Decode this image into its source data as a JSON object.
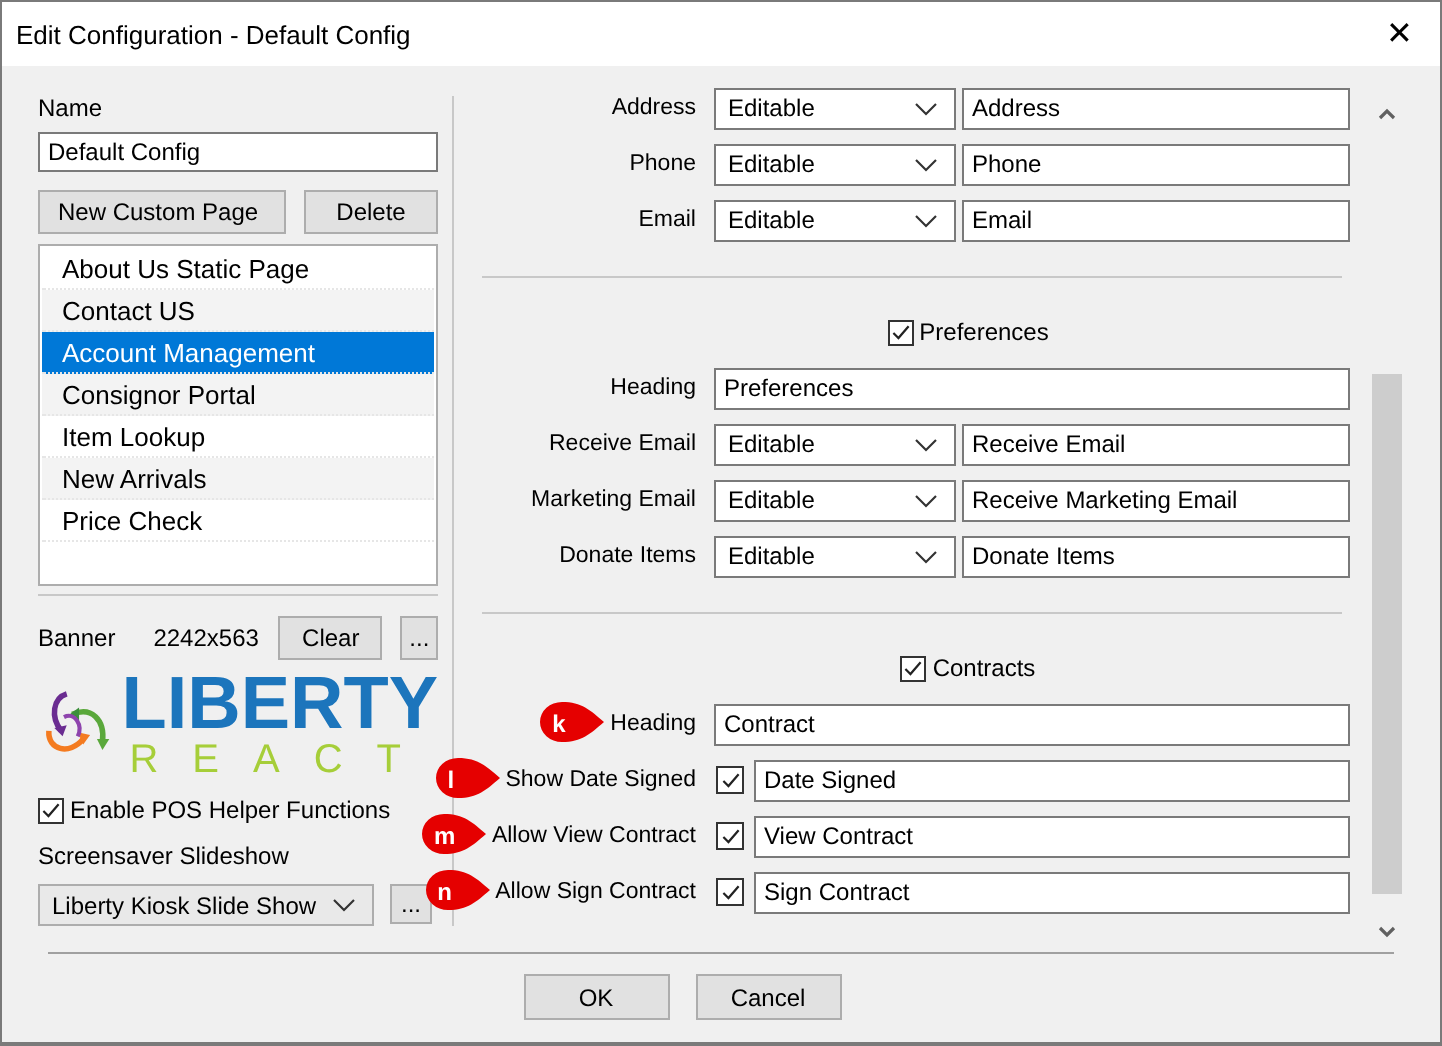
{
  "window": {
    "title": "Edit Configuration - Default Config",
    "close": "✕"
  },
  "left_panel": {
    "name_label": "Name",
    "name_value": "Default Config",
    "new_page_button": "New Custom Page",
    "delete_button": "Delete",
    "pages": [
      {
        "label": "About Us Static Page",
        "selected": false
      },
      {
        "label": "Contact US",
        "selected": false
      },
      {
        "label": "Account Management",
        "selected": true
      },
      {
        "label": "Consignor Portal",
        "selected": false
      },
      {
        "label": "Item Lookup",
        "selected": false
      },
      {
        "label": "New Arrivals",
        "selected": false
      },
      {
        "label": "Price Check",
        "selected": false
      }
    ],
    "banner_label": "Banner",
    "banner_size": "2242x563",
    "clear_button": "Clear",
    "banner_browse_button": "...",
    "logo": {
      "word_1": "LIBERTY",
      "word_2": "REACT"
    },
    "pos_helper": {
      "label": "Enable POS Helper Functions",
      "checked": true
    },
    "slideshow_label": "Screensaver Slideshow",
    "slideshow_value": "Liberty Kiosk Slide Show",
    "slideshow_browse_button": "..."
  },
  "sections": [
    {
      "rows": [
        {
          "kind": "select_text",
          "label": "Address",
          "mode": "Editable",
          "value": "Address"
        },
        {
          "kind": "select_text",
          "label": "Phone",
          "mode": "Editable",
          "value": "Phone"
        },
        {
          "kind": "select_text",
          "label": "Email",
          "mode": "Editable",
          "value": "Email"
        }
      ]
    },
    {
      "title": "Preferences",
      "checked": true,
      "rows": [
        {
          "kind": "text",
          "label": "Heading",
          "value": "Preferences"
        },
        {
          "kind": "select_text",
          "label": "Receive Email",
          "mode": "Editable",
          "value": "Receive Email"
        },
        {
          "kind": "select_text",
          "label": "Marketing Email",
          "mode": "Editable",
          "value": "Receive Marketing Email"
        },
        {
          "kind": "select_text",
          "label": "Donate Items",
          "mode": "Editable",
          "value": "Donate Items"
        }
      ]
    },
    {
      "title": "Contracts",
      "checked": true,
      "rows": [
        {
          "kind": "text",
          "label": "Heading",
          "value": "Contract",
          "callout": "k"
        },
        {
          "kind": "check_text",
          "label": "Show Date Signed",
          "checked": true,
          "value": "Date Signed",
          "callout": "l"
        },
        {
          "kind": "check_text",
          "label": "Allow View Contract",
          "checked": true,
          "value": "View Contract",
          "callout": "m"
        },
        {
          "kind": "check_text",
          "label": "Allow Sign Contract",
          "checked": true,
          "value": "Sign Contract",
          "callout": "n"
        }
      ]
    }
  ],
  "footer": {
    "buttons": [
      "OK",
      "Cancel"
    ]
  }
}
